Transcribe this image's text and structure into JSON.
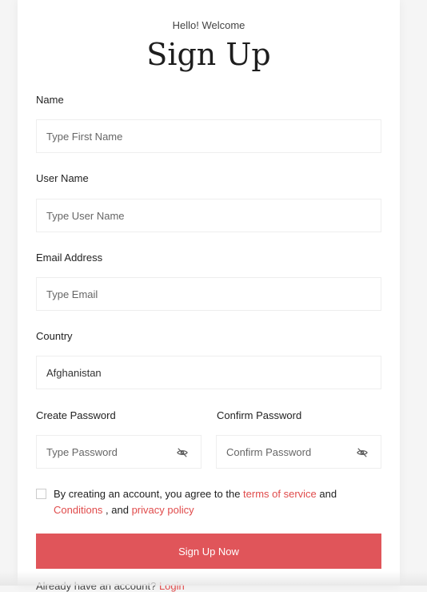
{
  "header": {
    "greeting": "Hello! Welcome",
    "title": "Sign Up"
  },
  "form": {
    "name": {
      "label": "Name",
      "placeholder": "Type First Name"
    },
    "username": {
      "label": "User Name",
      "placeholder": "Type User Name"
    },
    "email": {
      "label": "Email Address",
      "placeholder": "Type Email"
    },
    "country": {
      "label": "Country",
      "value": "Afghanistan"
    },
    "password": {
      "label": "Create Password",
      "placeholder": "Type Password",
      "icon": "eye-slash-icon"
    },
    "confirm_password": {
      "label": "Confirm Password",
      "placeholder": "Confirm Password",
      "icon": "eye-slash-icon"
    }
  },
  "agreement": {
    "text_before": "By creating an account, you agree to the ",
    "terms_link": "terms of service",
    "text_and": " and ",
    "conditions_link": "Conditions",
    "text_comma_and": " , and ",
    "privacy_link": "privacy policy"
  },
  "submit_label": "Sign Up Now",
  "footer": {
    "question": "Already have an account? ",
    "login_link": "Login"
  },
  "colors": {
    "accent": "#e0555a",
    "link": "#e04b4b",
    "background": "#f5f5f5"
  }
}
